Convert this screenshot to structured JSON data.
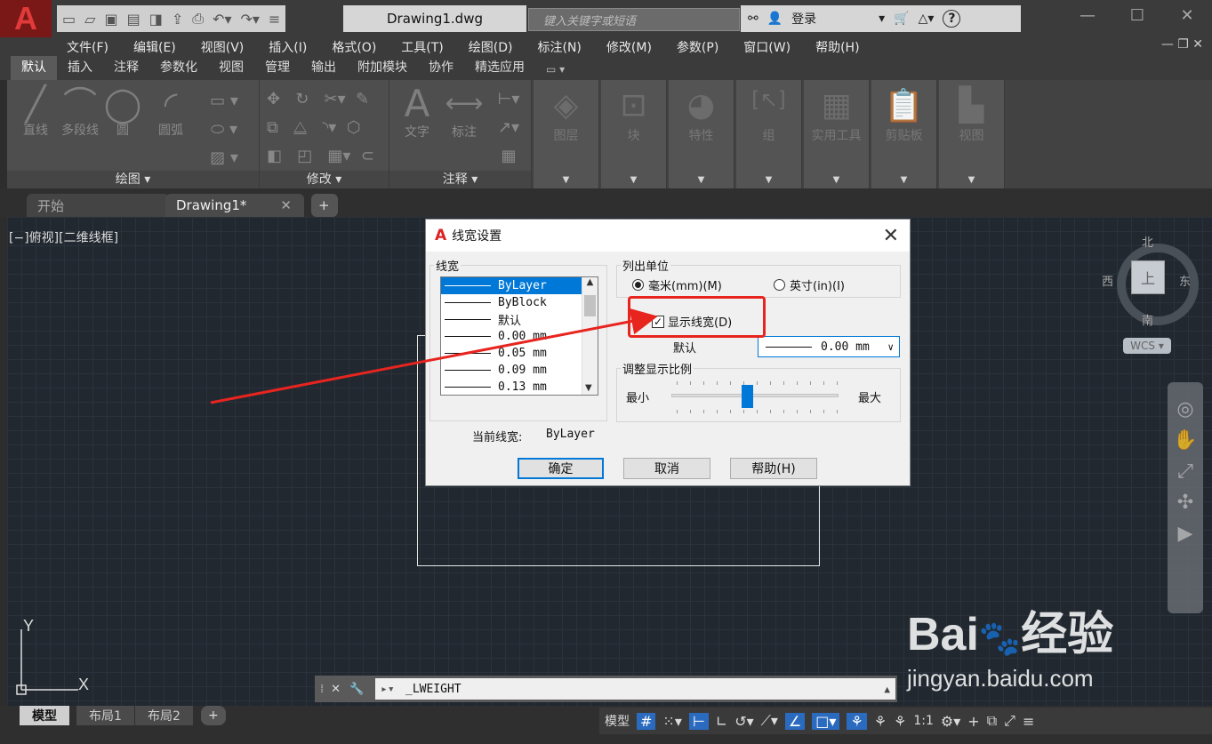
{
  "title_bar": {
    "logo": "A",
    "doc_title": "Drawing1.dwg",
    "search_placeholder": "键入关键字或短语",
    "login": "登录",
    "help": "?"
  },
  "menu": [
    "文件(F)",
    "编辑(E)",
    "视图(V)",
    "插入(I)",
    "格式(O)",
    "工具(T)",
    "绘图(D)",
    "标注(N)",
    "修改(M)",
    "参数(P)",
    "窗口(W)",
    "帮助(H)"
  ],
  "ribbon_tabs": [
    "默认",
    "插入",
    "注释",
    "参数化",
    "视图",
    "管理",
    "输出",
    "附加模块",
    "协作",
    "精选应用"
  ],
  "ribbon": {
    "draw_tools": [
      "直线",
      "多段线",
      "圆",
      "圆弧"
    ],
    "draw_title": "绘图",
    "modify_title": "修改",
    "annot_tools": [
      "文字",
      "标注"
    ],
    "annot_title": "注释",
    "dim_panels": [
      "图层",
      "块",
      "特性",
      "组",
      "实用工具",
      "剪贴板",
      "视图"
    ]
  },
  "file_tabs": {
    "start": "开始",
    "drawing": "Drawing1*",
    "add": "+"
  },
  "canvas": {
    "view_label": "[−]俯视][二维线框]",
    "compass": {
      "n": "北",
      "s": "南",
      "e": "东",
      "w": "西",
      "top": "上"
    },
    "wcs": "WCS",
    "axis_y": "Y",
    "axis_x": "X"
  },
  "dialog": {
    "title": "线宽设置",
    "lw_group": "线宽",
    "lw_items": [
      "ByLayer",
      "ByBlock",
      "默认",
      "0.00 mm",
      "0.05 mm",
      "0.09 mm",
      "0.13 mm"
    ],
    "lw_selected_index": 0,
    "units_group": "列出单位",
    "unit_mm": "毫米(mm)(M)",
    "unit_in": "英寸(in)(I)",
    "unit_selected": "mm",
    "show_lw": "显示线宽(D)",
    "show_lw_checked": true,
    "default_label": "默认",
    "default_value": "0.00 mm",
    "scale_group": "调整显示比例",
    "scale_min": "最小",
    "scale_max": "最大",
    "scale_level": 0.45,
    "current_label": "当前线宽:",
    "current_value": "ByLayer",
    "ok": "确定",
    "cancel": "取消",
    "help": "帮助(H)"
  },
  "cmdline": {
    "text": "_LWEIGHT"
  },
  "layout_tabs": [
    "模型",
    "布局1",
    "布局2",
    "+"
  ],
  "status": {
    "model": "模型",
    "scale": "1:1"
  },
  "watermark": {
    "brand": "Bai",
    "brand2": "经验",
    "url": "jingyan.baidu.com"
  },
  "colors": {
    "annotation_red": "#e8241f",
    "accent_blue": "#0078d7"
  }
}
